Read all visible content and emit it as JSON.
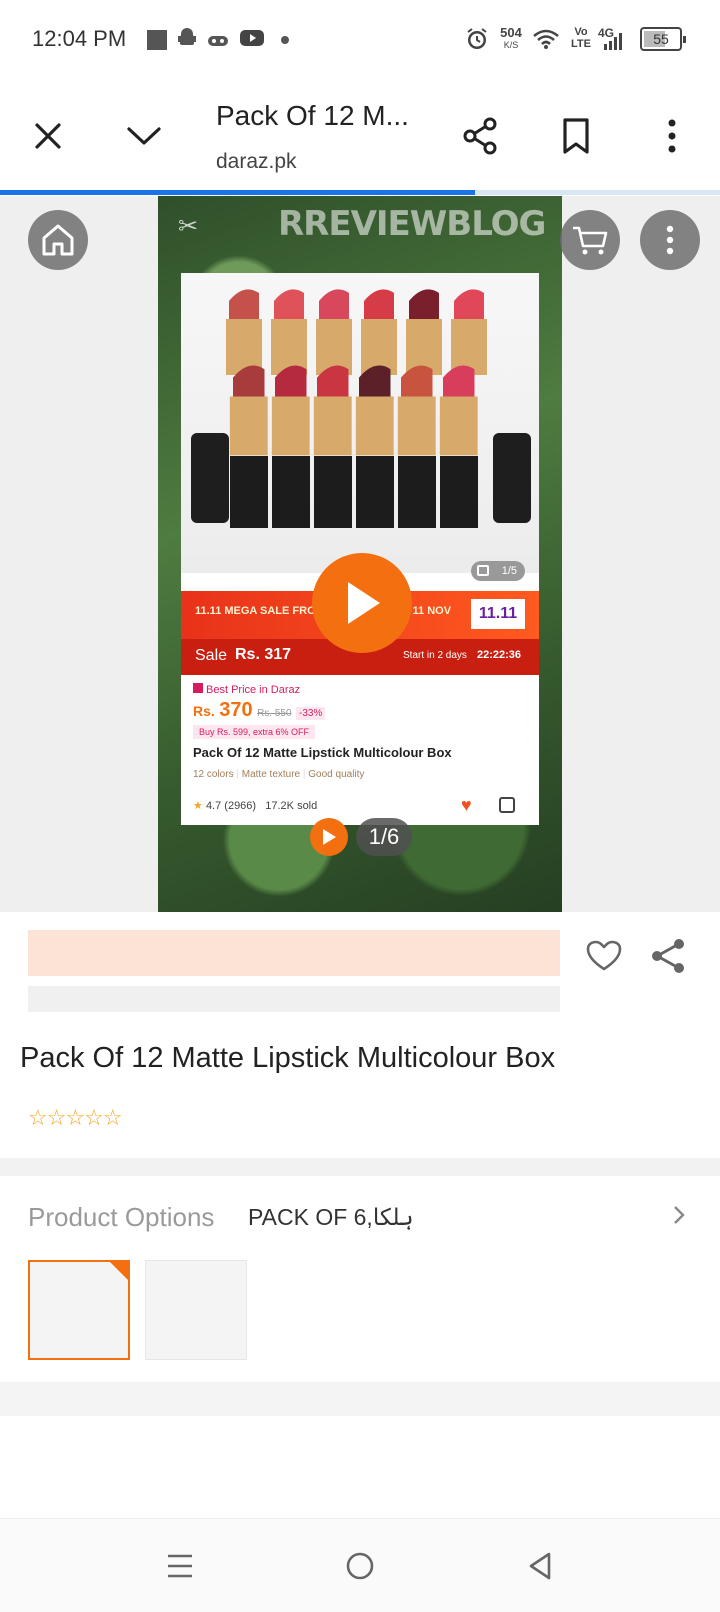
{
  "status_bar": {
    "time": "12:04 PM",
    "net_speed_value": "504",
    "net_speed_unit": "K/S",
    "volte": "Vo\nLTE",
    "network": "4G",
    "battery": "55",
    "icons": [
      "square-notification-icon",
      "android-icon",
      "gamepad-icon",
      "youtube-icon",
      "dot-icon",
      "alarm-icon",
      "wifi-icon",
      "signal-icon",
      "battery-icon"
    ]
  },
  "browser": {
    "title": "Pack Of 12 M...",
    "domain": "daraz.pk",
    "load_progress": 0.66,
    "icons": [
      "close-icon",
      "chevron-down-icon",
      "share-icon",
      "bookmark-icon",
      "more-vert-icon"
    ]
  },
  "gallery": {
    "watermark": "RREVIEWBLOG",
    "card": {
      "sale_band_text": "11.11 MEGA SALE FROM 10 NOV (8PM) ~ 11 NOV",
      "sale_badge": "11.11",
      "sale_label": "Sale",
      "sale_price": "Rs. 317",
      "start_text": "Start in 2 days",
      "countdown": "22:22:36",
      "media_counter": "1/5",
      "best_price": "Best Price in Daraz",
      "price_currency": "Rs.",
      "price": "370",
      "original_price": "Rs. 550",
      "discount": "-33%",
      "promo": "Buy Rs. 599, extra 6% OFF",
      "name": "Pack Of 12 Matte Lipstick Multicolour Box",
      "tags": [
        "12 colors",
        "Matte texture",
        "Good quality"
      ],
      "rating": "4.7 (2966)",
      "sold": "17.2K sold"
    },
    "slide_counter": "1/6",
    "accent": "#f36f10"
  },
  "product": {
    "title": "Pack Of 12 Matte Lipstick Multicolour Box",
    "stars": "☆☆☆☆☆",
    "options_label": "Product Options",
    "options_value": "PACK OF 6,ہلکا",
    "thumbnails": [
      {
        "selected": true
      },
      {
        "selected": false
      }
    ]
  },
  "lipsticks": {
    "top_colors": [
      "#c5524a",
      "#e0525a",
      "#d8475c",
      "#d63b48",
      "#7a1f2c",
      "#e0485a"
    ],
    "bottom_colors": [
      "#a83c3c",
      "#b52a3f",
      "#c93642",
      "#5c2028",
      "#c85440",
      "#d83e5c"
    ]
  },
  "nav": {
    "icons": [
      "recent-apps-icon",
      "home-circle-icon",
      "back-triangle-icon"
    ]
  }
}
